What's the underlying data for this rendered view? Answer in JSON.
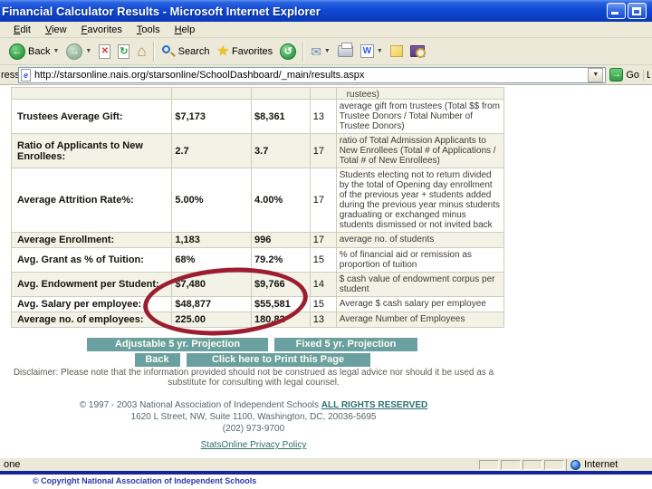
{
  "window": {
    "title": "Financial Calculator Results - Microsoft Internet Explorer"
  },
  "menu": {
    "items": [
      "Edit",
      "View",
      "Favorites",
      "Tools",
      "Help"
    ]
  },
  "toolbar": {
    "back_label": "Back",
    "search_label": "Search",
    "favorites_label": "Favorites",
    "word_glyph": "W"
  },
  "address": {
    "label_fragment": "ress",
    "url": "http://starsonline.nais.org/starsonline/SchoolDashboard/_main/results.aspx",
    "go_label": "Go",
    "links_fragment": "L"
  },
  "table": {
    "partial_row_description": "rustees)",
    "rows": [
      {
        "label": "Trustees Average Gift:",
        "value1": "$7,173",
        "value2": "$8,361",
        "count": "13",
        "description": "average gift from trustees (Total $$ from Trustee Donors / Total Number of Trustee Donors)"
      },
      {
        "label": "Ratio of Applicants to New Enrollees:",
        "value1": "2.7",
        "value2": "3.7",
        "count": "17",
        "description": "ratio of Total Admission Applicants to New Enrollees (Total # of Applications / Total # of New Enrollees)"
      },
      {
        "label": "Average Attrition Rate%:",
        "value1": "5.00%",
        "value2": "4.00%",
        "count": "17",
        "description": "Students electing not to return divided by the total of Opening day enrollment of the previous year + students added during the previous year minus students graduating or exchanged minus students dismissed or not invited back"
      },
      {
        "label": "Average Enrollment:",
        "value1": "1,183",
        "value2": "996",
        "count": "17",
        "description": "average no. of students"
      },
      {
        "label": "Avg. Grant as % of Tuition:",
        "value1": "68%",
        "value2": "79.2%",
        "count": "15",
        "description": "% of financial aid or remission as proportion of tuition"
      },
      {
        "label": "Avg. Endowment per Student:",
        "value1": "$7,480",
        "value2": "$9,766",
        "count": "14",
        "description": "$ cash value of endowment corpus per student"
      },
      {
        "label": "Avg. Salary per employee:",
        "value1": "$48,877",
        "value2": "$55,581",
        "count": "15",
        "description": "Average $ cash salary per employee"
      },
      {
        "label": "Average no. of employees:",
        "value1": "225.00",
        "value2": "180.82",
        "count": "13",
        "description": "Average Number of Employees"
      }
    ]
  },
  "actions": {
    "adjustable": "Adjustable 5 yr. Projection",
    "fixed": "Fixed 5 yr. Projection",
    "back": "Back",
    "print": "Click here to Print this Page"
  },
  "disclaimer": "Disclaimer: Please note that the information provided should not be construed as legal advice nor should it be used as a substitute for consulting with legal counsel.",
  "footer": {
    "copyright_line": "© 1997 - 2003 National Association of Independent Schools",
    "rights_link": "ALL RIGHTS RESERVED",
    "address_line": "1620 L Street, NW, Suite 1100, Washington, DC, 20036-5695",
    "phone": "(202) 973-9700",
    "privacy_link": "StatsOnline Privacy Policy"
  },
  "status_bar": {
    "left": "one",
    "zone": "Internet"
  },
  "slide": {
    "copyright": "© Copyright National Association of Independent Schools"
  },
  "colors": {
    "titlebar_blue": "#1149d6",
    "button_teal": "#6aa0a0",
    "annotation_red": "#9c1d31",
    "link_teal": "#2f6f6f",
    "chrome_beige": "#ece9d8"
  }
}
